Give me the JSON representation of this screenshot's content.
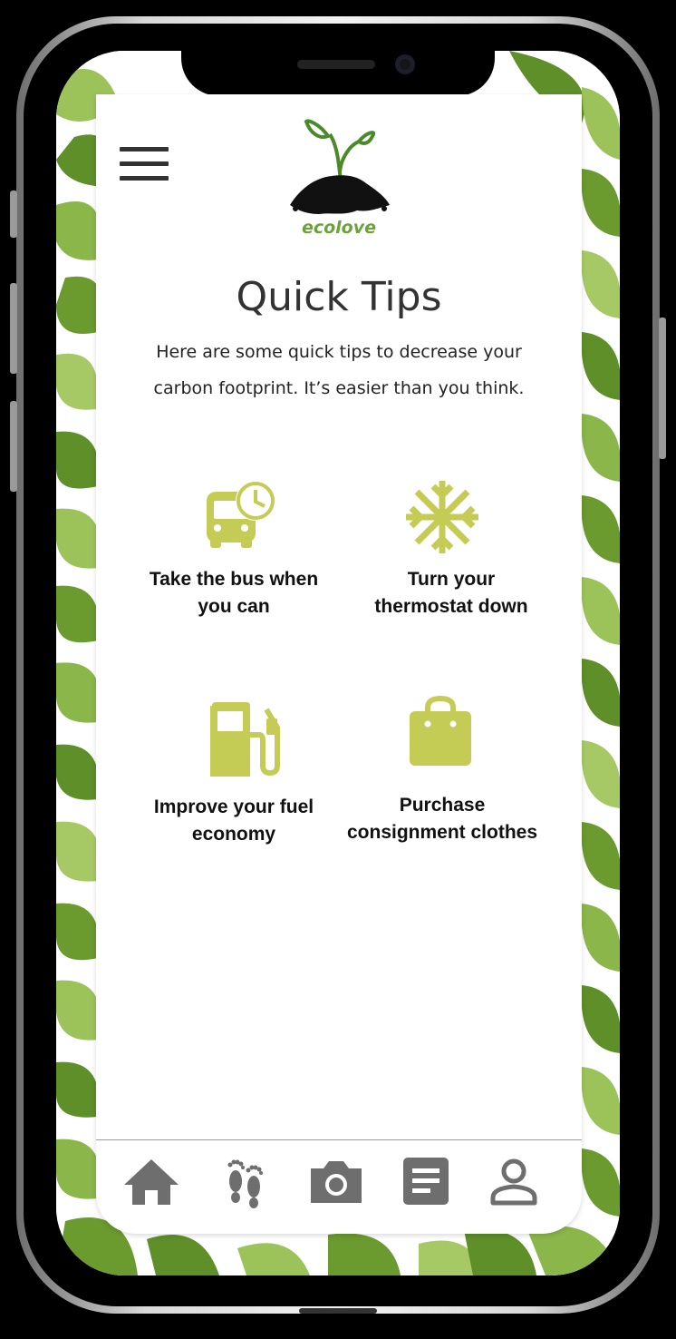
{
  "app": {
    "logo_text": "ecolove"
  },
  "header": {
    "title": "Quick Tips",
    "subtitle": "Here are some quick tips to decrease your carbon footprint. It’s easier than you think."
  },
  "tips": [
    {
      "label_line1": "Take the bus when",
      "label_line2": "you can",
      "icon": "bus-clock-icon"
    },
    {
      "label_line1": "Turn your",
      "label_line2": "thermostat down",
      "icon": "snowflake-icon"
    },
    {
      "label_line1": "Improve your fuel",
      "label_line2": "economy",
      "icon": "fuel-pump-icon"
    },
    {
      "label_line1": "Purchase",
      "label_line2": "consignment clothes",
      "icon": "shopping-bag-icon"
    }
  ],
  "bottom_nav": [
    {
      "icon": "home-icon"
    },
    {
      "icon": "footprints-icon"
    },
    {
      "icon": "camera-icon"
    },
    {
      "icon": "article-icon"
    },
    {
      "icon": "profile-icon"
    }
  ],
  "colors": {
    "accent": "#c5cc55",
    "logo_green": "#6aa33b",
    "nav_icon": "#6e6e6e",
    "leaf_dark": "#5e8f28",
    "leaf_light": "#9cc35a"
  }
}
